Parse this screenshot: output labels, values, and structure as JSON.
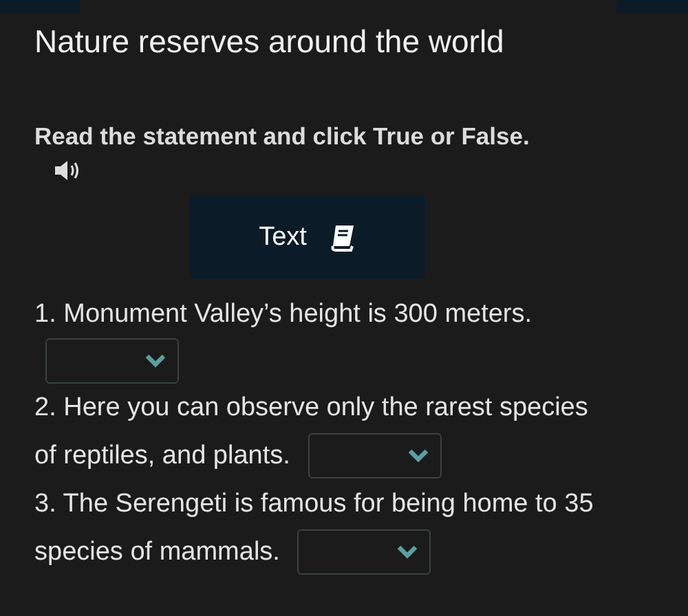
{
  "title": "Nature reserves around the world",
  "instruction": "Read the statement and click True or False.",
  "text_button": {
    "label": "Text"
  },
  "statements": [
    {
      "lines": [
        "1. Monument Valley’s height is 300 meters."
      ]
    },
    {
      "lines": [
        "2. Here you can observe only the rarest species",
        "of reptiles, and plants."
      ]
    },
    {
      "lines": [
        "3. The Serengeti is famous for being home to 35",
        "species of mammals."
      ]
    }
  ]
}
